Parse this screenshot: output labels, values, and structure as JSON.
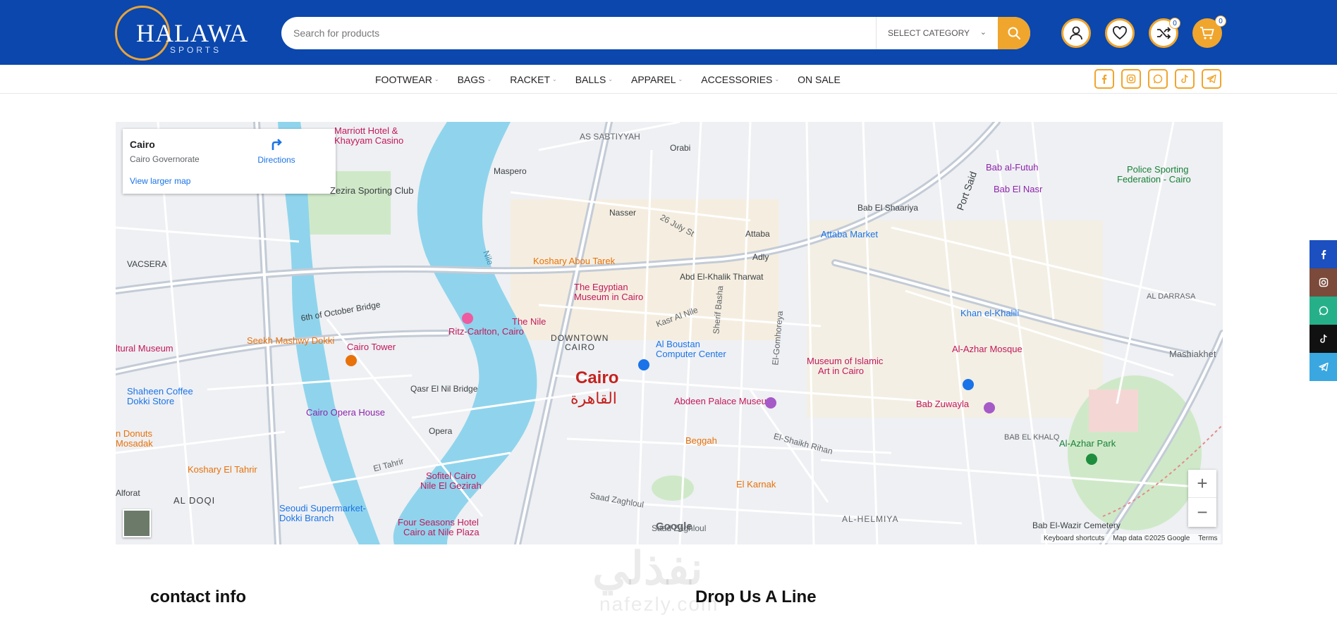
{
  "header": {
    "logo_text": "HALAWA",
    "logo_sub": "SPORTS",
    "search_placeholder": "Search for products",
    "category_label": "SELECT CATEGORY",
    "compare_count": "0",
    "cart_count": "0"
  },
  "nav": {
    "items": [
      {
        "label": "FOOTWEAR",
        "has_dropdown": true
      },
      {
        "label": "BAGS",
        "has_dropdown": true
      },
      {
        "label": "RACKET",
        "has_dropdown": true
      },
      {
        "label": "BALLS",
        "has_dropdown": true
      },
      {
        "label": "APPAREL",
        "has_dropdown": true
      },
      {
        "label": "ACCESSORIES",
        "has_dropdown": true
      },
      {
        "label": "ON SALE",
        "has_dropdown": false
      }
    ],
    "social_icons": [
      "facebook-icon",
      "instagram-icon",
      "whatsapp-icon",
      "tiktok-icon",
      "telegram-icon"
    ]
  },
  "map": {
    "place_name": "Cairo",
    "place_region": "Cairo Governorate",
    "directions_label": "Directions",
    "view_larger": "View larger map",
    "city_label": "Cairo",
    "city_label_ar": "القاهرة",
    "downtown": "DOWNTOWN",
    "downtown2": "CAIRO",
    "river": "Nile",
    "brand": "Google",
    "attribution": {
      "shortcuts": "Keyboard shortcuts",
      "data": "Map data ©2025 Google",
      "terms": "Terms"
    },
    "labels": {
      "marriott": "Marriott Hotel &",
      "khayyam": "Khayyam Casino",
      "zsc": "Zezira Sporting Club",
      "sabtiyyah": "AS SABTIYYAH",
      "maspero": "Maspero",
      "orabi": "Orabi",
      "nasser": "Nasser",
      "july": "26 July St",
      "attaba": "Attaba",
      "adly": "Adly",
      "attaba_market": "Attaba Market",
      "koshary": "Koshary Abou Tarek",
      "egyptian": "The Egyptian",
      "museum": "Museum in Cairo",
      "nile_ritz": "The Nile",
      "ritz": "Ritz-Carlton, Cairo",
      "cairo_tower": "Cairo Tower",
      "opera_house": "Cairo Opera House",
      "opera": "Opera",
      "qasr": "Qasr El Nil Bridge",
      "october": "6th of October Bridge",
      "sofitel": "Sofitel Cairo",
      "sofitel2": "Nile El Gezirah",
      "four_seasons": "Four Seasons Hotel",
      "four_seasons2": "Cairo at Nile Plaza",
      "seoudi": "Seoudi Supermarket-",
      "seoudi2": "Dokki Branch",
      "koshary_tahrir": "Koshary El Tahrir",
      "shaheen": "Shaheen Coffee",
      "shaheen2": "Dokki Store",
      "seekh": "Seekh Mashwy Dokki",
      "vacsera": "VACSERA",
      "doqi": "AL DOQI",
      "alforat": "Alforat",
      "donuts": "n Donuts",
      "mosadak": "Mosadak",
      "agri": "ltural Museum",
      "boustan": "Al Boustan",
      "boustan2": "Computer Center",
      "abdeen": "Abdeen Palace Museum",
      "beggah": "Beggah",
      "karnak": "El Karnak",
      "islamic": "Museum of Islamic",
      "islamic2": "Art in Cairo",
      "khalili": "Khan el-Khalili",
      "azhar_mosque": "Al-Azhar Mosque",
      "azhar_park": "Al-Azhar Park",
      "zuwayla": "Bab Zuwayla",
      "futuh": "Bab al-Futuh",
      "nasr": "Bab El Nasr",
      "shaariya": "Bab El Shaariya",
      "police": "Police Sporting",
      "police2": "Federation - Cairo",
      "darrasa": "AL DARRASA",
      "mashiakhet": "Mashiakhet",
      "khalq": "BAB EL KHALQ",
      "helmiya": "AL-HELMIYA",
      "wazir": "Bab El-Wazir Cemetery",
      "port_said": "Port Said",
      "gomhoreya": "El-Gomhoreya",
      "sherif": "Sherif Basha",
      "tharwat": "Abd El-Khalik Tharwat",
      "kasr": "Kasr Al Nile",
      "tahrir": "El Tahrir",
      "shiekh_rihan": "El-Shaikh Rihan",
      "saad": "Saad Zaghloul",
      "saad2": "Saad Zaghloul"
    }
  },
  "side_socials": [
    "facebook-icon",
    "instagram-icon",
    "whatsapp-icon",
    "tiktok-icon",
    "telegram-icon"
  ],
  "footer": {
    "contact_title": "contact info",
    "drop_title": "Drop Us A Line"
  },
  "watermark": {
    "ar": "نفذلي",
    "en": "nafezly.com"
  },
  "colors": {
    "brand_blue": "#0b47ad",
    "accent_orange": "#f0a52c",
    "facebook": "#1c4fbf",
    "instagram": "#7b4a3a",
    "whatsapp": "#26b08a",
    "tiktok": "#111111",
    "telegram": "#3aa7e0"
  }
}
